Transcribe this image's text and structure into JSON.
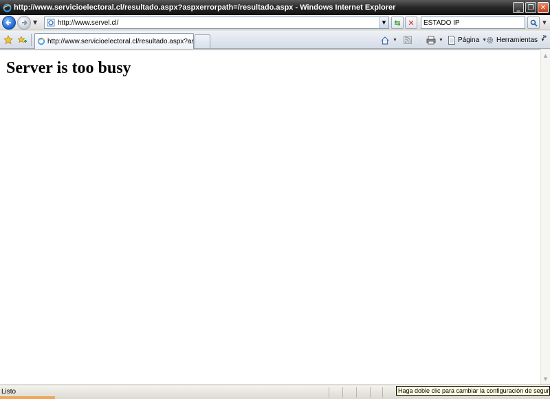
{
  "window": {
    "title": "http://www.servicioelectoral.cl/resultado.aspx?aspxerrorpath=/resultado.aspx - Windows Internet Explorer",
    "minimize_label": "_",
    "restore_label": "❐",
    "close_label": "✕"
  },
  "address_bar": {
    "url": "http://www.servel.cl/"
  },
  "search": {
    "value": "ESTADO IP"
  },
  "tabs": [
    {
      "label": "http://www.servicioelectoral.cl/resultado.aspx?aspxe..."
    }
  ],
  "commands": {
    "page_label": "Página",
    "tools_label": "Herramientas"
  },
  "content": {
    "heading": "Server is too busy"
  },
  "status": {
    "text": "Listo",
    "tooltip": "Haga doble clic para cambiar la configuración de seguridad"
  },
  "colors": {
    "titlebar": "#2a2a2a",
    "accent_blue": "#1a5fcb",
    "tooltip_bg": "#ffffe1"
  }
}
